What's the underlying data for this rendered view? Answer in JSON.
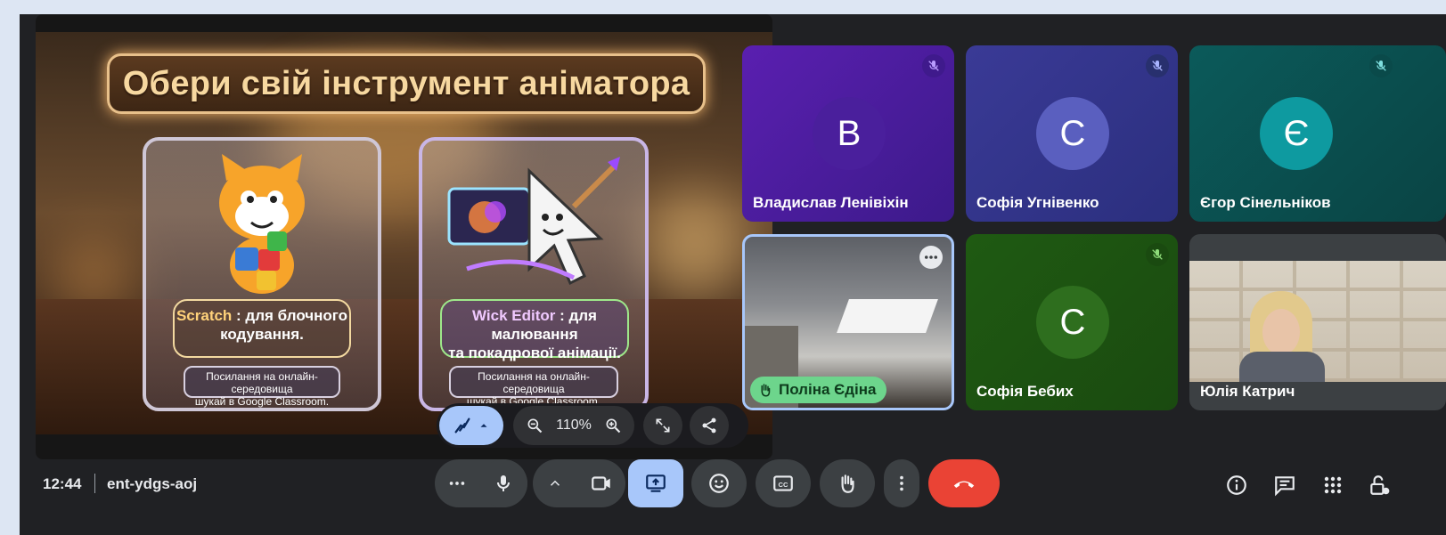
{
  "slide": {
    "title": "Обери свій інструмент аніматора",
    "card_left": {
      "name": "Scratch",
      "desc_line1": " : для блочного",
      "desc_line2": "кодування.",
      "foot_line1": "Посилання на онлайн-середовища",
      "foot_line2": "шукай в Google Classroom."
    },
    "card_right": {
      "name": "Wick Editor",
      "desc_line1": " : для малювання",
      "desc_line2": "та покадрової анімації.",
      "foot_line1": "Посилання на онлайн-середовища",
      "foot_line2": "шукай в Google Classroom."
    }
  },
  "slide_toolbar": {
    "zoom": "110%"
  },
  "participants": [
    {
      "name": "Владислав Ленівіхін",
      "initial": "В",
      "muted": true
    },
    {
      "name": "Софія Угнівенко",
      "initial": "С",
      "muted": true
    },
    {
      "name": "Єгор Сінельніков",
      "initial": "Є",
      "muted": true
    },
    {
      "name": "Поліна Єдіна",
      "initial": "",
      "muted": false
    },
    {
      "name": "Софія Бебих",
      "initial": "С",
      "muted": true
    },
    {
      "name": "Юлія Катрич",
      "initial": "",
      "muted": false
    }
  ],
  "bottom_bar": {
    "time": "12:44",
    "meeting_code": "ent-ydgs-aoj"
  },
  "colors": {
    "accent_blue": "#a8c7fa",
    "end_call_red": "#ea4335",
    "raise_hand_green": "#6dd58c"
  },
  "icons": [
    "mic-icon",
    "camera-icon",
    "present-icon",
    "emoji-icon",
    "captions-icon",
    "hand-icon",
    "more-icon",
    "end-call-icon",
    "info-icon",
    "chat-icon",
    "activities-icon",
    "host-controls-icon"
  ]
}
